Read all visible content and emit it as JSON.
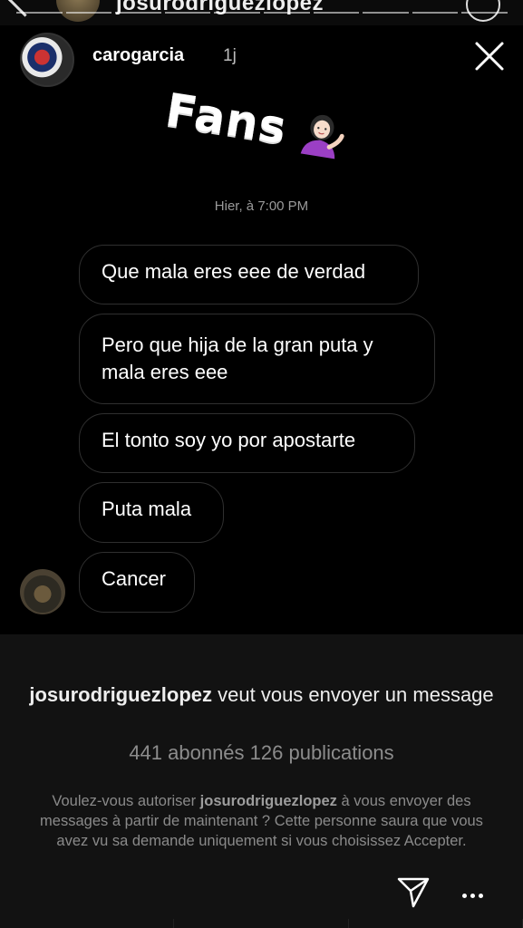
{
  "top": {
    "username": "josurodriguezlopez",
    "back_icon": "chevron-left-icon",
    "info_icon": "info-icon"
  },
  "story": {
    "username": "carogarcia",
    "age": "1j",
    "close_icon": "close-icon",
    "sticker_text": "Fans",
    "sticker_emoji": "woman-tipping-hand-emoji"
  },
  "thread": {
    "timestamp": "Hier, à 7:00 PM",
    "messages": [
      "Que mala eres eee de verdad",
      "Pero que hija de la gran puta y mala eres eee",
      "El tonto soy yo por apostarte",
      "Puta mala",
      "Cancer"
    ]
  },
  "request": {
    "username": "josurodriguezlopez",
    "title_suffix": " veut vous envoyer un message",
    "stats": "441 abonnés 126 publications",
    "body_prefix": "Voulez-vous autoriser ",
    "body_suffix": " à vous envoyer des messages à partir de maintenant ? Cette personne saura que vous avez vu sa demande uniquement si vous choisissez Accepter.",
    "send_icon": "send-icon",
    "more_icon": "more-icon"
  },
  "colors": {
    "background": "#000000",
    "panel": "#121212",
    "bubble_border": "#2f2f2f",
    "muted_text": "#8a8a8a"
  }
}
